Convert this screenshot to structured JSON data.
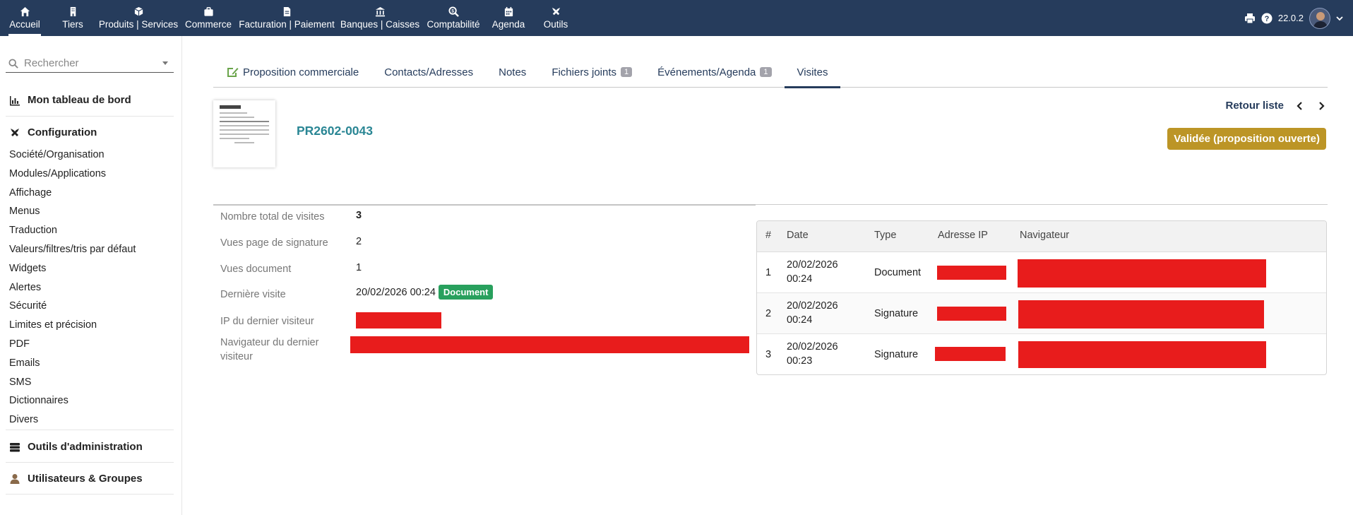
{
  "topbar": {
    "menu": [
      {
        "label": "Accueil",
        "icon": "home-icon",
        "active": true
      },
      {
        "label": "Tiers",
        "icon": "building-icon"
      },
      {
        "label": "Produits | Services",
        "icon": "cube-icon"
      },
      {
        "label": "Commerce",
        "icon": "briefcase-icon"
      },
      {
        "label": "Facturation | Paiement",
        "icon": "invoice-icon"
      },
      {
        "label": "Banques | Caisses",
        "icon": "bank-icon"
      },
      {
        "label": "Comptabilité",
        "icon": "search-dollar-icon"
      },
      {
        "label": "Agenda",
        "icon": "calendar-icon"
      },
      {
        "label": "Outils",
        "icon": "tools-icon"
      }
    ],
    "version": "22.0.2",
    "colors": {
      "bar": "#263c5c"
    }
  },
  "sidebar": {
    "search_placeholder": "Rechercher",
    "dashboard": "Mon tableau de bord",
    "configuration": "Configuration",
    "items": [
      "Société/Organisation",
      "Modules/Applications",
      "Affichage",
      "Menus",
      "Traduction",
      "Valeurs/filtres/tris par défaut",
      "Widgets",
      "Alertes",
      "Sécurité",
      "Limites et précision",
      "PDF",
      "Emails",
      "SMS",
      "Dictionnaires",
      "Divers"
    ],
    "admin_tools": "Outils d'administration",
    "users_groups": "Utilisateurs & Groupes"
  },
  "tabs": [
    {
      "label": "Proposition commerciale",
      "icon": "proposal-icon"
    },
    {
      "label": "Contacts/Adresses"
    },
    {
      "label": "Notes"
    },
    {
      "label": "Fichiers joints",
      "badge": "1"
    },
    {
      "label": "Événements/Agenda",
      "badge": "1"
    },
    {
      "label": "Visites",
      "active": true
    }
  ],
  "header": {
    "ref": "PR2602-0043",
    "back_list": "Retour liste",
    "status": "Validée (proposition ouverte)",
    "status_color": "#bc9526"
  },
  "info": {
    "total_visits_label": "Nombre total de visites",
    "total_visits": "3",
    "signature_views_label": "Vues page de signature",
    "signature_views": "2",
    "doc_views_label": "Vues document",
    "doc_views": "1",
    "last_visit_label": "Dernière visite",
    "last_visit": "20/02/2026 00:24",
    "last_visit_badge": "Document",
    "last_ip_label": "IP du dernier visiteur",
    "last_browser_label": "Navigateur du dernier visiteur"
  },
  "visits": {
    "headers": [
      "#",
      "Date",
      "Type",
      "Adresse IP",
      "Navigateur"
    ],
    "rows": [
      {
        "num": "1",
        "date": "20/02/2026",
        "time": "00:24",
        "type": "Document"
      },
      {
        "num": "2",
        "date": "20/02/2026",
        "time": "00:24",
        "type": "Signature"
      },
      {
        "num": "3",
        "date": "20/02/2026",
        "time": "00:23",
        "type": "Signature"
      }
    ]
  }
}
